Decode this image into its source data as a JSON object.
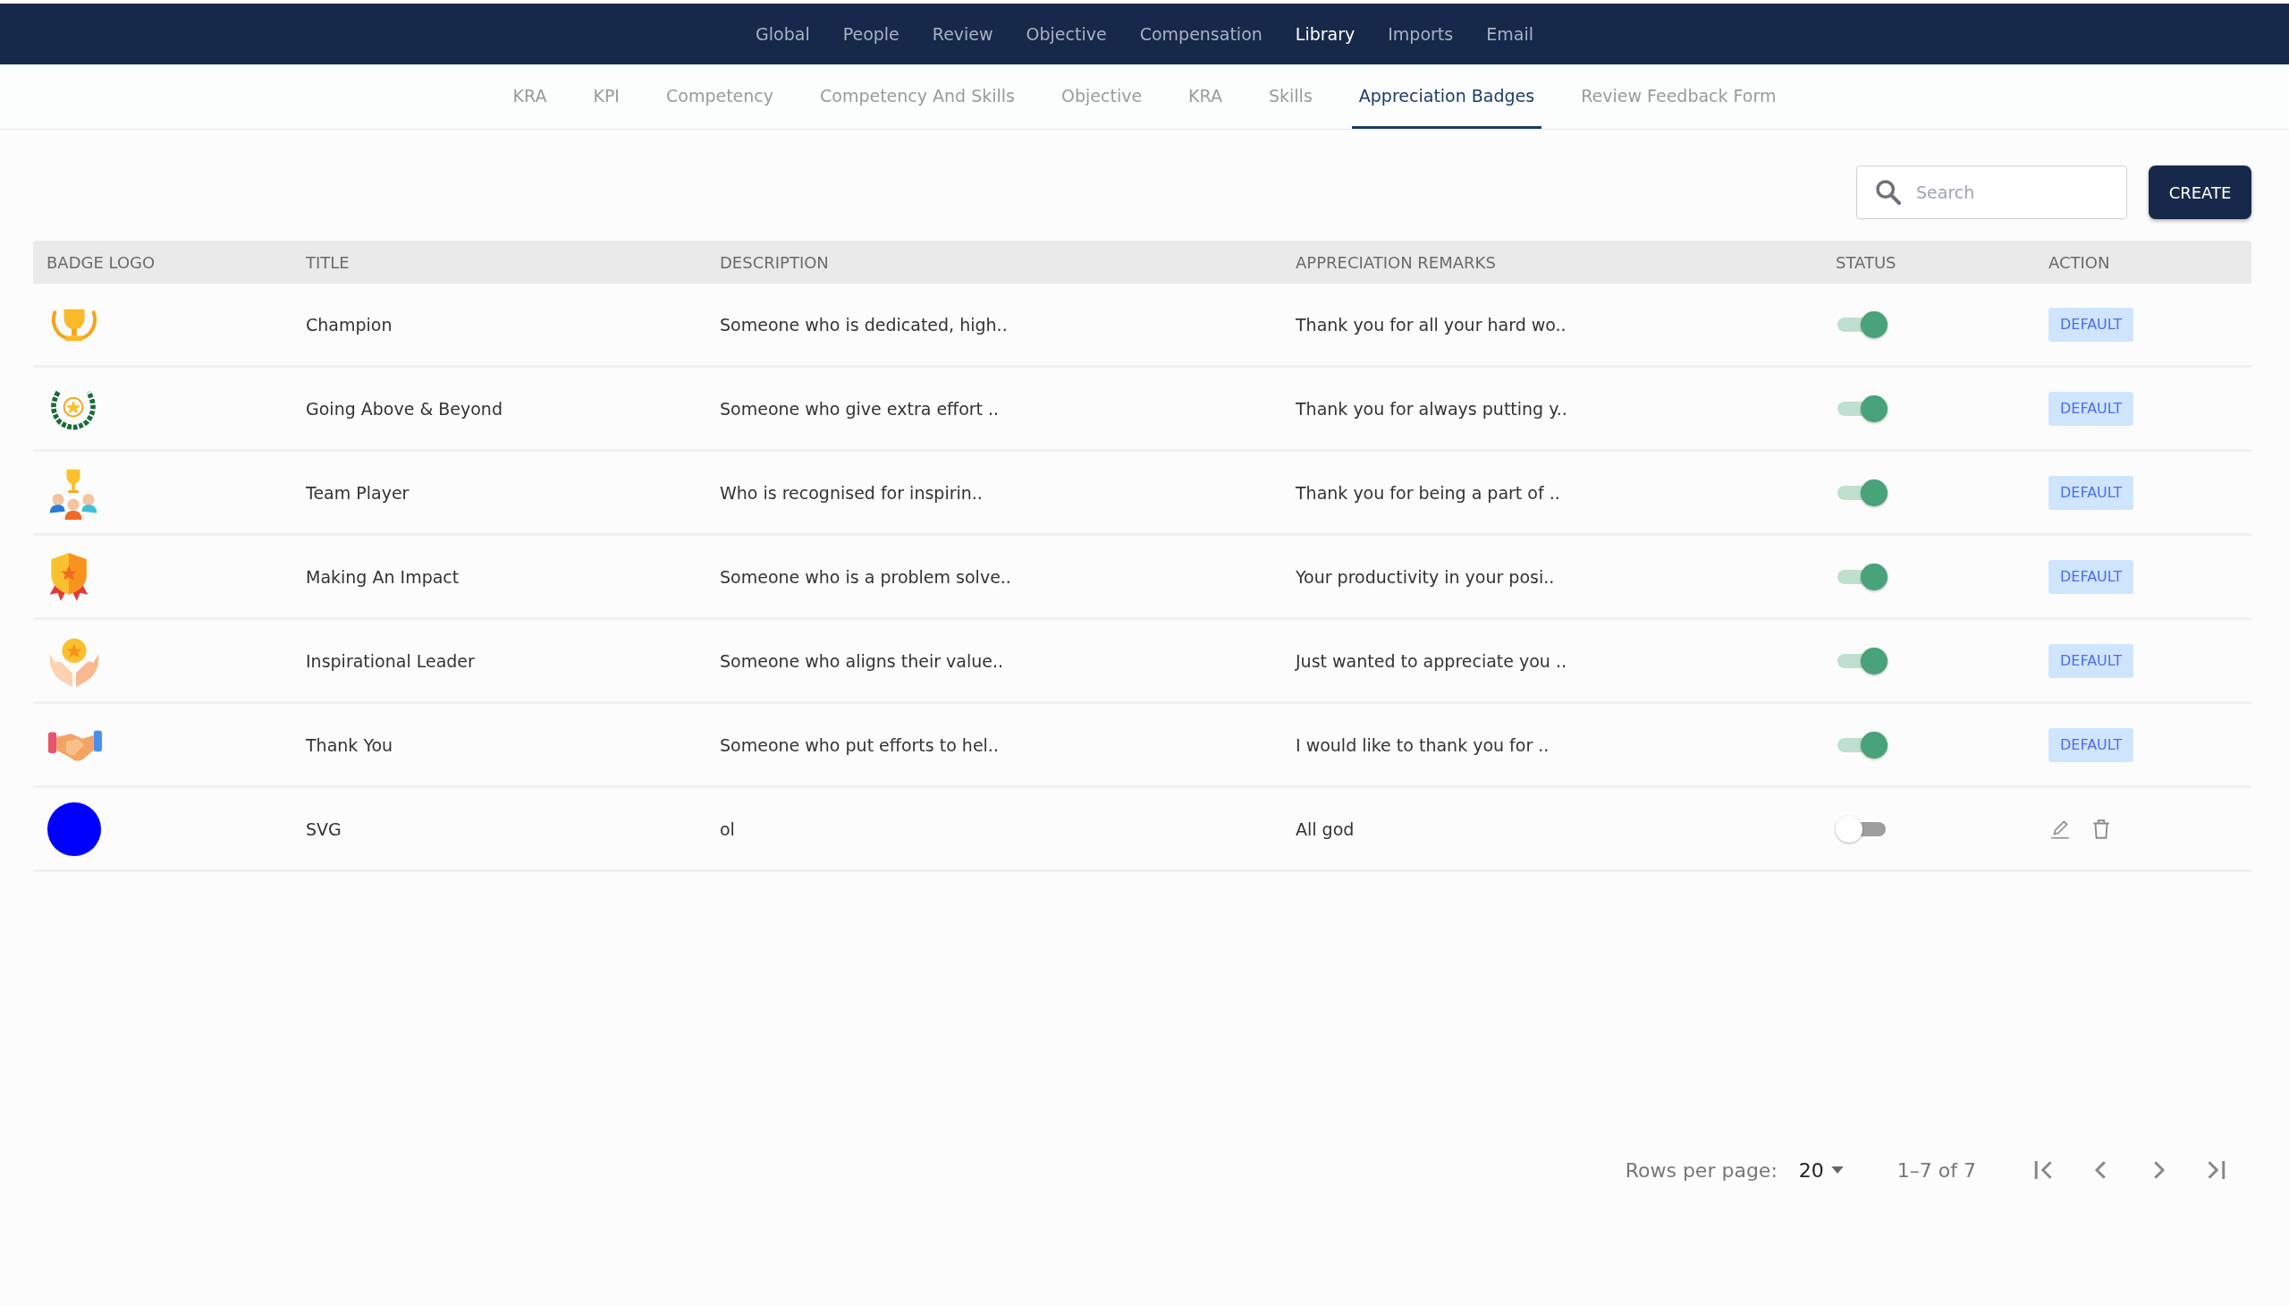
{
  "top_nav": [
    {
      "label": "Global",
      "selected": false
    },
    {
      "label": "People",
      "selected": false
    },
    {
      "label": "Review",
      "selected": false
    },
    {
      "label": "Objective",
      "selected": false
    },
    {
      "label": "Compensation",
      "selected": false
    },
    {
      "label": "Library",
      "selected": true
    },
    {
      "label": "Imports",
      "selected": false
    },
    {
      "label": "Email",
      "selected": false
    }
  ],
  "sub_tabs": [
    {
      "label": "KRA",
      "selected": false
    },
    {
      "label": "KPI",
      "selected": false
    },
    {
      "label": "Competency",
      "selected": false
    },
    {
      "label": "Competency And Skills",
      "selected": false
    },
    {
      "label": "Objective",
      "selected": false
    },
    {
      "label": "KRA",
      "selected": false
    },
    {
      "label": "Skills",
      "selected": false
    },
    {
      "label": "Appreciation Badges",
      "selected": true
    },
    {
      "label": "Review Feedback Form",
      "selected": false
    }
  ],
  "search": {
    "placeholder": "Search"
  },
  "create_button": "CREATE",
  "table": {
    "columns": [
      "BADGE LOGO",
      "TITLE",
      "DESCRIPTION",
      "APPRECIATION REMARKS",
      "STATUS",
      "ACTION"
    ],
    "rows": [
      {
        "title": "Champion",
        "description": "Someone who is dedicated, high..",
        "remarks": "Thank you for all your hard wo..",
        "on": true,
        "action": {
          "kind": "badge",
          "label": "DEFAULT"
        }
      },
      {
        "title": "Going Above & Beyond",
        "description": "Someone who give extra effort ..",
        "remarks": "Thank you for always putting y..",
        "on": true,
        "action": {
          "kind": "badge",
          "label": "DEFAULT"
        }
      },
      {
        "title": "Team Player",
        "description": "Who is recognised for inspirin..",
        "remarks": "Thank you for being a part of ..",
        "on": true,
        "action": {
          "kind": "badge",
          "label": "DEFAULT"
        }
      },
      {
        "title": "Making An Impact",
        "description": "Someone who is a problem solve..",
        "remarks": "Your productivity in your posi..",
        "on": true,
        "action": {
          "kind": "badge",
          "label": "DEFAULT"
        }
      },
      {
        "title": "Inspirational Leader",
        "description": "Someone who aligns their value..",
        "remarks": "Just wanted to appreciate you ..",
        "on": true,
        "action": {
          "kind": "badge",
          "label": "DEFAULT"
        }
      },
      {
        "title": "Thank You",
        "description": "Someone who put efforts to hel..",
        "remarks": "I would like to thank you for ..",
        "on": true,
        "action": {
          "kind": "badge",
          "label": "DEFAULT"
        }
      },
      {
        "title": "SVG",
        "description": "ol",
        "remarks": "All god",
        "on": false,
        "action": {
          "kind": "icons"
        }
      }
    ]
  },
  "pagination": {
    "rows_per_page_label": "Rows per page:",
    "rows_per_page": "20",
    "range": "1–7 of 7"
  }
}
